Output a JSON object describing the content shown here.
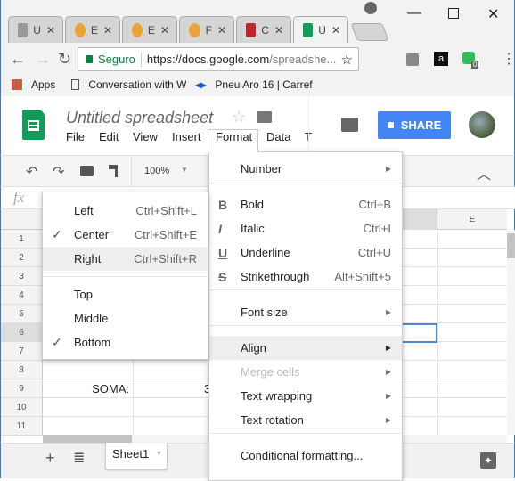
{
  "browser": {
    "tabs": [
      {
        "label": "U",
        "icon": "ufpr-favicon"
      },
      {
        "label": "E",
        "icon": "puzzle-favicon"
      },
      {
        "label": "E",
        "icon": "puzzle-favicon"
      },
      {
        "label": "F",
        "icon": "puzzle-favicon"
      },
      {
        "label": "C",
        "icon": "qi-favicon"
      },
      {
        "label": "U",
        "icon": "sheets-favicon",
        "active": true
      }
    ],
    "secure_label": "Seguro",
    "url_host": "https://docs.google.com",
    "url_path": "/spreadshe...",
    "bookmarks": [
      {
        "label": "Apps"
      },
      {
        "label": "Conversation with W"
      },
      {
        "label": "Pneu Aro 16 | Carref"
      }
    ],
    "extension_badge": "0"
  },
  "doc": {
    "title": "Untitled spreadsheet",
    "menu": [
      "File",
      "Edit",
      "View",
      "Insert",
      "Format",
      "Data",
      "T"
    ],
    "share_label": "SHARE",
    "zoom": "100%",
    "fx": "fx"
  },
  "grid": {
    "rows": [
      "1",
      "2",
      "3",
      "4",
      "5",
      "6",
      "7",
      "8",
      "9",
      "10",
      "11"
    ],
    "col_e": "E",
    "cell_a9": "SOMA:",
    "cell_b9_partial": "3"
  },
  "format_menu": {
    "items": [
      {
        "label": "Number",
        "arrow": true
      },
      {
        "label": "Bold",
        "icon": "B",
        "shortcut": "Ctrl+B"
      },
      {
        "label": "Italic",
        "icon": "I",
        "shortcut": "Ctrl+I"
      },
      {
        "label": "Underline",
        "icon": "U",
        "shortcut": "Ctrl+U"
      },
      {
        "label": "Strikethrough",
        "icon": "S",
        "shortcut": "Alt+Shift+5"
      },
      {
        "label": "Font size",
        "arrow": true
      },
      {
        "label": "Align",
        "arrow": true,
        "highlighted": true
      },
      {
        "label": "Merge cells",
        "arrow": true,
        "disabled": true
      },
      {
        "label": "Text wrapping",
        "arrow": true
      },
      {
        "label": "Text rotation",
        "arrow": true
      },
      {
        "label": "Conditional formatting..."
      }
    ]
  },
  "align_submenu": {
    "items": [
      {
        "label": "Left",
        "shortcut": "Ctrl+Shift+L"
      },
      {
        "label": "Center",
        "shortcut": "Ctrl+Shift+E",
        "checked": true
      },
      {
        "label": "Right",
        "shortcut": "Ctrl+Shift+R",
        "highlighted": true
      },
      {
        "label": "Top"
      },
      {
        "label": "Middle"
      },
      {
        "label": "Bottom",
        "checked": true
      }
    ]
  },
  "sheets": {
    "tabs": [
      "Sheet1"
    ]
  },
  "colors": {
    "accent": "#4285f4",
    "sheets_green": "#0f9d58",
    "selection": "#4a89dc"
  }
}
